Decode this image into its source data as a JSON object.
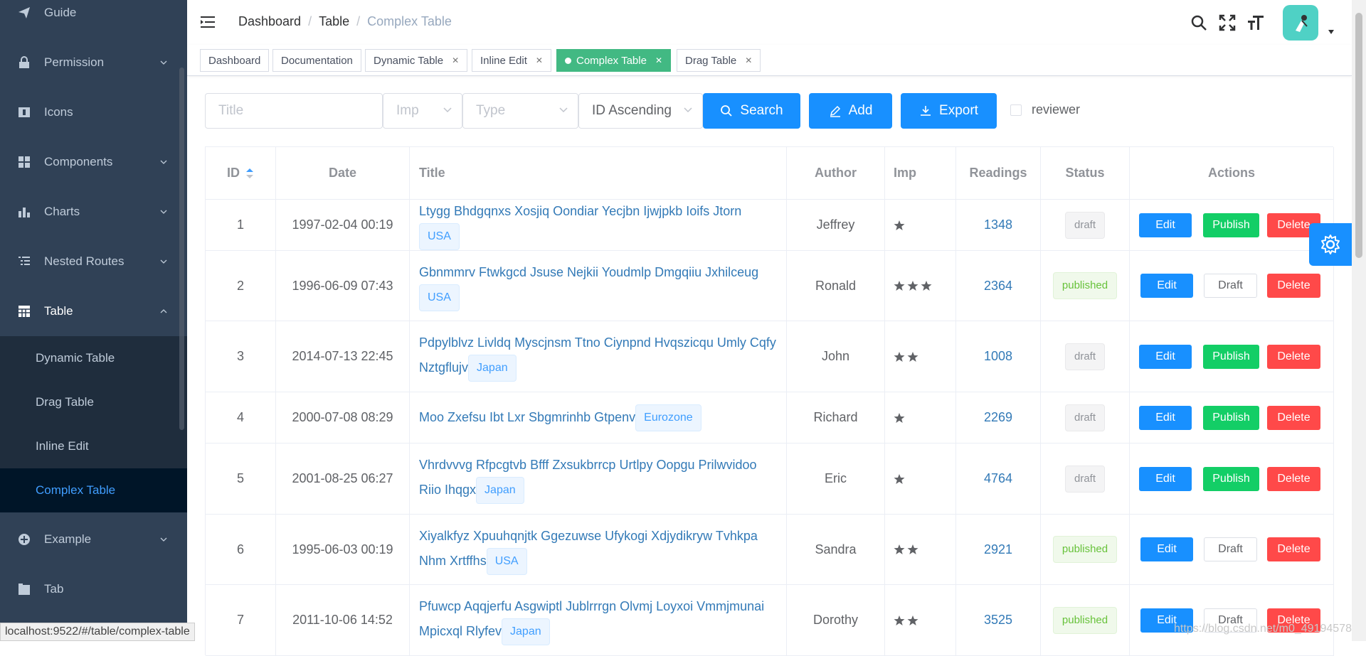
{
  "sidebar": {
    "items": [
      {
        "label": "Guide",
        "icon": "guide-icon",
        "has_children": false
      },
      {
        "label": "Permission",
        "icon": "lock-icon",
        "has_children": true
      },
      {
        "label": "Icons",
        "icon": "icons-icon",
        "has_children": false
      },
      {
        "label": "Components",
        "icon": "components-icon",
        "has_children": true
      },
      {
        "label": "Charts",
        "icon": "chart-icon",
        "has_children": true
      },
      {
        "label": "Nested Routes",
        "icon": "nested-icon",
        "has_children": true
      },
      {
        "label": "Table",
        "icon": "table-icon",
        "has_children": true,
        "open": true
      },
      {
        "label": "Example",
        "icon": "example-icon",
        "has_children": true
      },
      {
        "label": "Tab",
        "icon": "tab-icon",
        "has_children": false
      }
    ],
    "table_children": [
      {
        "label": "Dynamic Table",
        "active": false
      },
      {
        "label": "Drag Table",
        "active": false
      },
      {
        "label": "Inline Edit",
        "active": false
      },
      {
        "label": "Complex Table",
        "active": true
      }
    ]
  },
  "breadcrumb": [
    "Dashboard",
    "Table",
    "Complex Table"
  ],
  "tags": [
    {
      "label": "Dashboard",
      "closable": false,
      "active": false
    },
    {
      "label": "Documentation",
      "closable": false,
      "active": false
    },
    {
      "label": "Dynamic Table",
      "closable": true,
      "active": false
    },
    {
      "label": "Inline Edit",
      "closable": true,
      "active": false
    },
    {
      "label": "Complex Table",
      "closable": true,
      "active": true
    },
    {
      "label": "Drag Table",
      "closable": true,
      "active": false
    }
  ],
  "filters": {
    "title_placeholder": "Title",
    "imp_placeholder": "Imp",
    "type_placeholder": "Type",
    "sort_value": "ID Ascending",
    "search_label": "Search",
    "add_label": "Add",
    "export_label": "Export",
    "reviewer_label": "reviewer"
  },
  "table": {
    "headers": [
      "ID",
      "Date",
      "Title",
      "Author",
      "Imp",
      "Readings",
      "Status",
      "Actions"
    ],
    "rows": [
      {
        "id": "1",
        "date": "1997-02-04 00:19",
        "title": "Ltygg Bhdgqnxs Xosjiq Oondiar Yecjbn Ijwjpkb Ioifs Jtorn",
        "tag": "USA",
        "author": "Jeffrey",
        "imp": 1,
        "readings": "1348",
        "status": "draft",
        "actions": [
          "Edit",
          "Publish",
          "Delete"
        ]
      },
      {
        "id": "2",
        "date": "1996-06-09 07:43",
        "title": "Gbnmmrv Ftwkgcd Jsuse Nejkii Youdmlp Dmgqiiu Jxhilceug",
        "tag": "USA",
        "author": "Ronald",
        "imp": 3,
        "readings": "2364",
        "status": "published",
        "actions": [
          "Edit",
          "Draft",
          "Delete"
        ]
      },
      {
        "id": "3",
        "date": "2014-07-13 22:45",
        "title": "Pdpylblvz Livldq Myscjnsm Ttno Ciynpnd Hvqszicqu Umly Cqfy Nztgflujv",
        "tag": "Japan",
        "author": "John",
        "imp": 2,
        "readings": "1008",
        "status": "draft",
        "actions": [
          "Edit",
          "Publish",
          "Delete"
        ]
      },
      {
        "id": "4",
        "date": "2000-07-08 08:29",
        "title": "Moo Zxefsu Ibt Lxr Sbgmrinhb Gtpenv",
        "tag": "Eurozone",
        "author": "Richard",
        "imp": 1,
        "readings": "2269",
        "status": "draft",
        "actions": [
          "Edit",
          "Publish",
          "Delete"
        ]
      },
      {
        "id": "5",
        "date": "2001-08-25 06:27",
        "title": "Vhrdvvvg Rfpcgtvb Bfff Zxsukbrrcp Urtlpy Oopgu Prilwvidoo Riio Ihqgx",
        "tag": "Japan",
        "author": "Eric",
        "imp": 1,
        "readings": "4764",
        "status": "draft",
        "actions": [
          "Edit",
          "Publish",
          "Delete"
        ]
      },
      {
        "id": "6",
        "date": "1995-06-03 00:19",
        "title": "Xiyalkfyz Xpuuhqnjtk Ggezuwse Ufykogi Xdjydikryw Tvhkpa Nhm Xrtffhs",
        "tag": "USA",
        "author": "Sandra",
        "imp": 2,
        "readings": "2921",
        "status": "published",
        "actions": [
          "Edit",
          "Draft",
          "Delete"
        ]
      },
      {
        "id": "7",
        "date": "2011-10-06 14:52",
        "title": "Pfuwcp Aqqjerfu Asgwiptl Jublrrrgn Olvmj Loyxoi Vmmjmunai Mpicxql Rlyfev",
        "tag": "Japan",
        "author": "Dorothy",
        "imp": 2,
        "readings": "3525",
        "status": "published",
        "actions": [
          "Edit",
          "Draft",
          "Delete"
        ]
      }
    ]
  },
  "status_bar": "localhost:9522/#/table/complex-table",
  "watermark": "https://blog.csdn.net/m0_49194578",
  "colors": {
    "sidebar_bg": "#304156",
    "primary": "#1890ff",
    "success": "#13ce66",
    "danger": "#ff4949",
    "tag_active": "#42b983"
  }
}
